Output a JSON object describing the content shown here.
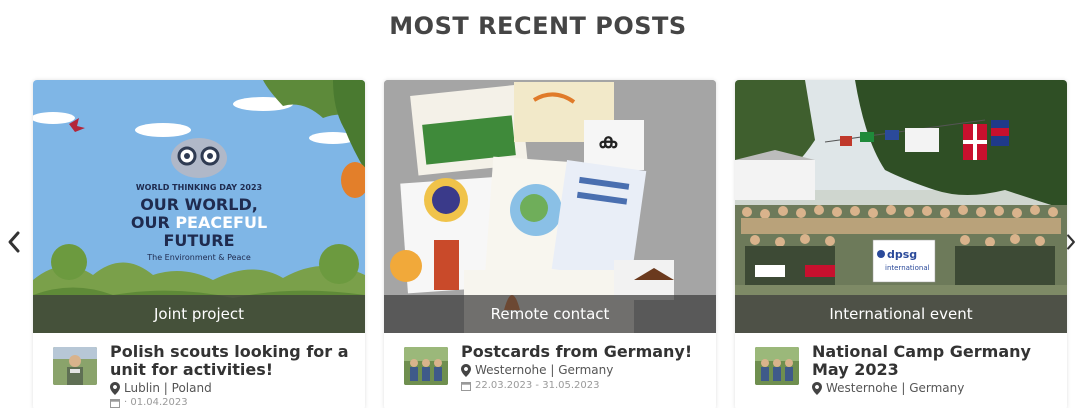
{
  "section": {
    "title": "MOST RECENT POSTS"
  },
  "carousel": {
    "prev_icon": "chevron-left-icon",
    "next_icon": "chevron-right-icon"
  },
  "posts": [
    {
      "category": "Joint project",
      "title_line1": "Polish scouts looking for a",
      "title_line2": "unit for activities!",
      "location": "Lublin | Poland",
      "date": "· 01.04.2023",
      "image_text": {
        "line1": "WORLD THINKING DAY 2023",
        "line2": "OUR WORLD,",
        "line3a": "OUR ",
        "line3b": "PEACEFUL",
        "line4": "FUTURE",
        "line5": "The Environment & Peace"
      }
    },
    {
      "category": "Remote contact",
      "title_line1": "Postcards from Germany!",
      "title_line2": "",
      "location": "Westernohe | Germany",
      "date": "22.03.2023 - 31.05.2023"
    },
    {
      "category": "International event",
      "title_line1": "National Camp Germany",
      "title_line2": "May 2023",
      "location": "Westernohe | Germany",
      "date": "",
      "image_text": {
        "banner": "dpsg",
        "banner_sub": "international"
      }
    }
  ],
  "colors": {
    "title": "#454545",
    "band": "#3c3c3c",
    "sky": "#7fb6e6",
    "grass": "#7aa04a"
  }
}
